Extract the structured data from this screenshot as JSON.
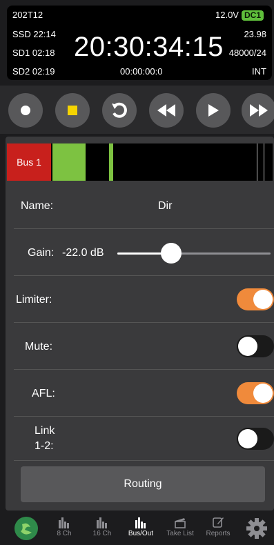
{
  "status": {
    "tl_top": "202T12",
    "voltage": "12.0V",
    "power_badge": "DC1",
    "ssd": "SSD 22:14",
    "sd1": "SD1 02:18",
    "sd2": "SD2 02:19",
    "timecode": "20:30:34:15",
    "framerate": "23.98",
    "sample": "48000/24",
    "elapsed": "00:00:00:0",
    "tc_source": "INT"
  },
  "transport": {
    "record_icon": "record-icon",
    "stop_icon": "stop-icon",
    "undo_icon": "undo-icon",
    "rewind_icon": "rewind-icon",
    "play_icon": "play-icon",
    "forward_icon": "fast-forward-icon"
  },
  "bus": {
    "name": "Bus 1",
    "name_label": "Name:",
    "name_value": "Dir",
    "gain_label": "Gain:",
    "gain_value": "-22.0 dB",
    "gain_level": 0.35,
    "limiter_label": "Limiter:",
    "limiter_on": true,
    "mute_label": "Mute:",
    "mute_on": false,
    "afl_label": "AFL:",
    "afl_on": true,
    "link_label_1": "Link",
    "link_label_2": "1-2:",
    "link_on": false,
    "routing_label": "Routing"
  },
  "colors": {
    "accent_orange": "#f08a3b",
    "meter_green": "#7dc241",
    "bus_red": "#c8201c",
    "power_green": "#5fbe3b"
  },
  "tabbar": {
    "tabs": [
      {
        "label": "",
        "icon": "app-logo-icon"
      },
      {
        "label": "8 Ch",
        "icon": "bars-icon"
      },
      {
        "label": "16 Ch",
        "icon": "bars-icon"
      },
      {
        "label": "Bus/Out",
        "icon": "bars-icon",
        "active": true
      },
      {
        "label": "Take List",
        "icon": "clapper-icon"
      },
      {
        "label": "Reports",
        "icon": "edit-icon"
      },
      {
        "label": "",
        "icon": "gear-icon"
      }
    ]
  }
}
